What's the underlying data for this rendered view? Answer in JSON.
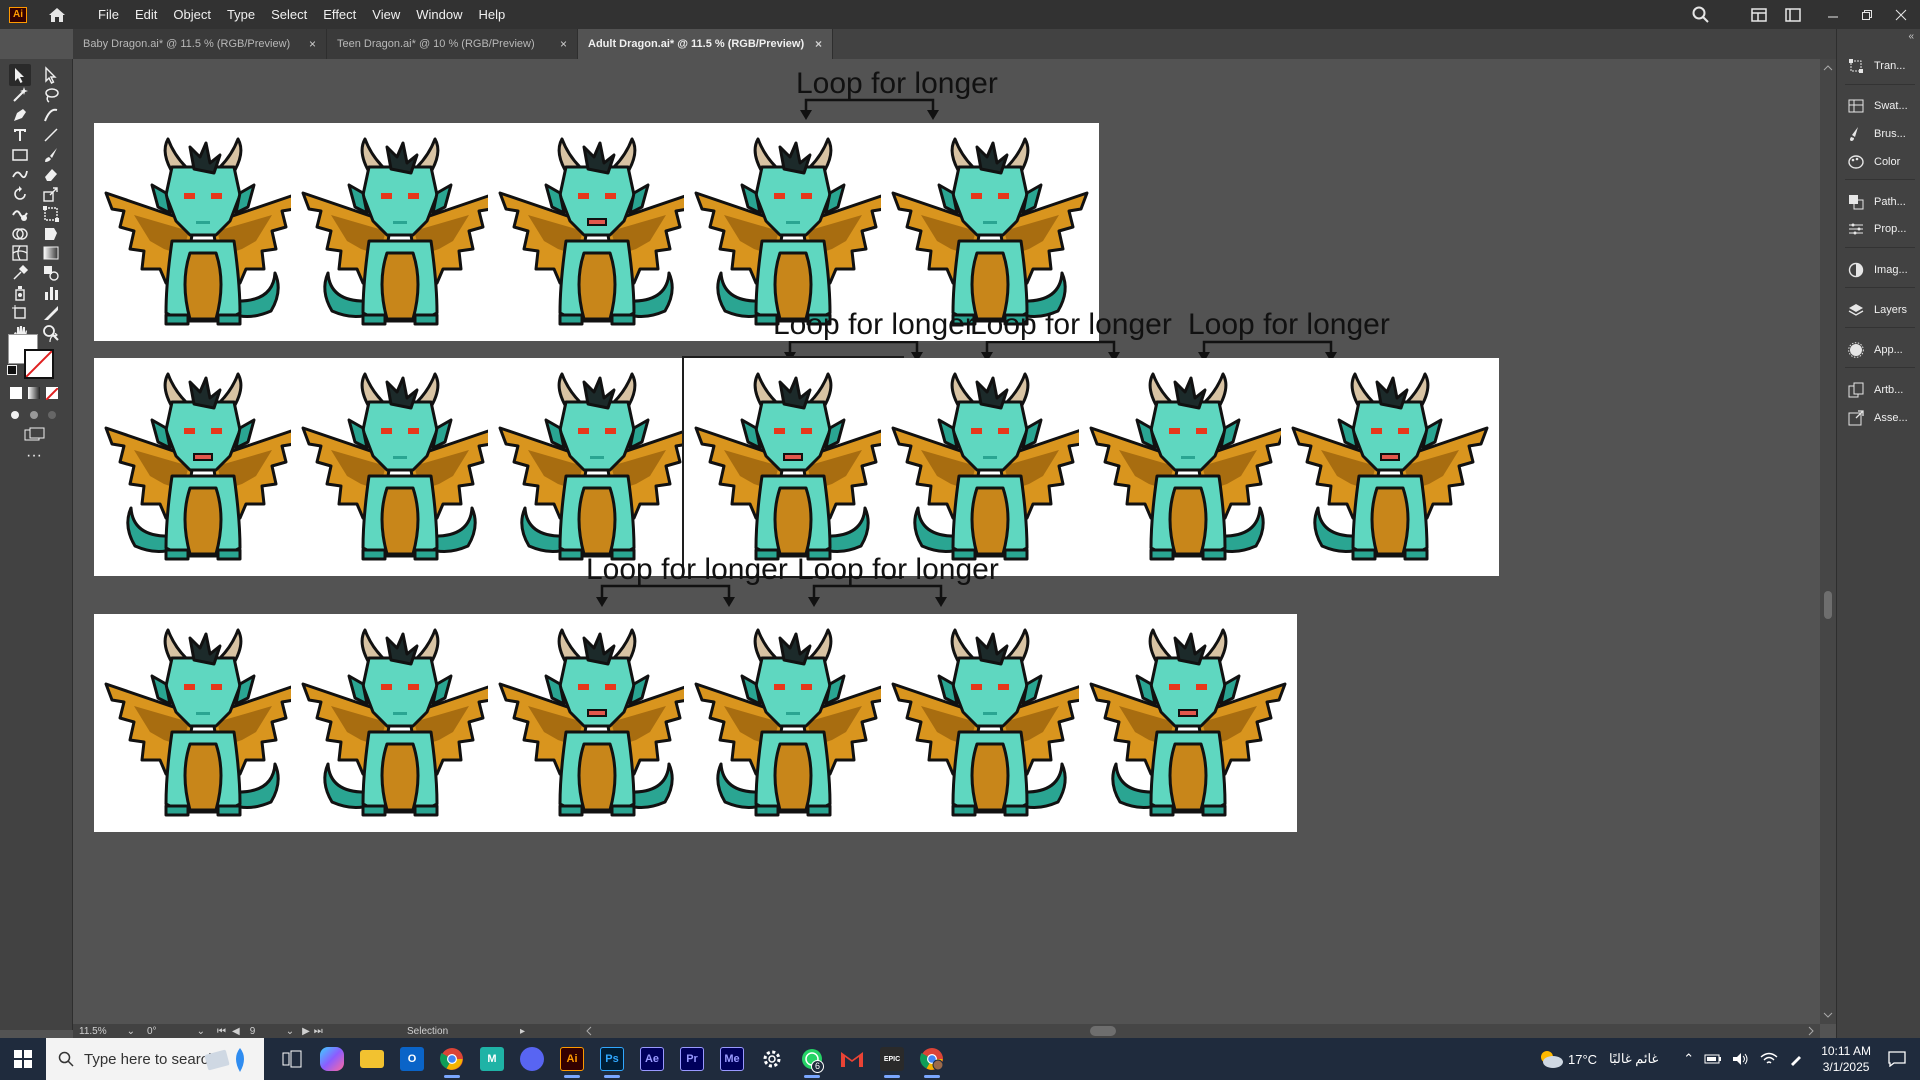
{
  "app": {
    "logo_text": "Ai",
    "menu": [
      "File",
      "Edit",
      "Object",
      "Type",
      "Select",
      "Effect",
      "View",
      "Window",
      "Help"
    ]
  },
  "tabs": [
    {
      "label": "Baby Dragon.ai* @ 11.5 % (RGB/Preview)",
      "active": false
    },
    {
      "label": "Teen Dragon.ai* @ 10 % (RGB/Preview)",
      "active": false
    },
    {
      "label": "Adult Dragon.ai* @ 11.5 % (RGB/Preview)",
      "active": true
    }
  ],
  "tab_close_glyph": "×",
  "canvas": {
    "loop_label": "Loop for longer",
    "artboard_rows": [
      5,
      7,
      6
    ],
    "selected_artboard": "row2-4",
    "colors": {
      "body": "#5fd7c0",
      "body_dark": "#2aa592",
      "wing": "#d9951e",
      "wing_dark": "#a86d10",
      "belly": "#c8861a",
      "horn": "#d8c3a3",
      "eye": "#e8371b",
      "outline": "#111111"
    }
  },
  "statusbar": {
    "zoom": "11.5%",
    "rotation": "0°",
    "artboard_number": "9",
    "tool": "Selection"
  },
  "right_panel": {
    "items": [
      "Tran...",
      "Swat...",
      "Brus...",
      "Color",
      "Path...",
      "Prop...",
      "Imag...",
      "Layers",
      "App...",
      "Artb...",
      "Asse..."
    ]
  },
  "taskbar": {
    "search_placeholder": "Type here to search",
    "apps": [
      "Task View",
      "Copilot",
      "File Explorer",
      "Outlook",
      "Chrome",
      "Maya",
      "Discord",
      "Illustrator",
      "Photoshop",
      "After Effects",
      "Premiere Pro",
      "Media Encoder",
      "Settings",
      "WhatsApp",
      "Gmail",
      "Epic Games",
      "Chrome Profile"
    ],
    "app_labels": {
      "illustrator": "Ai",
      "photoshop": "Ps",
      "after_effects": "Ae",
      "premiere": "Pr",
      "media_encoder": "Me",
      "maya": "M",
      "epic": "EPIC"
    },
    "whatsapp_badge": "6",
    "weather_temp": "17°C",
    "weather_text": "غائم غالبًا",
    "time": "10:11 AM",
    "date": "3/1/2025"
  }
}
